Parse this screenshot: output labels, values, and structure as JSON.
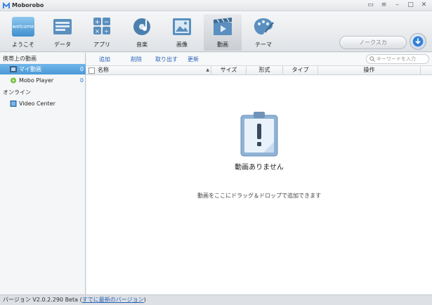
{
  "window": {
    "title": "Moborobo"
  },
  "toolbar": {
    "tabs": [
      {
        "label": "ようこそ",
        "icon": "welcome-icon"
      },
      {
        "label": "データ",
        "icon": "data-icon"
      },
      {
        "label": "アプリ",
        "icon": "apps-icon"
      },
      {
        "label": "音楽",
        "icon": "music-icon"
      },
      {
        "label": "画像",
        "icon": "image-icon"
      },
      {
        "label": "動画",
        "icon": "video-icon",
        "active": true
      },
      {
        "label": "テーマ",
        "icon": "theme-icon"
      }
    ],
    "welcome_badge": "welcome",
    "search_pill": "ノークスカ"
  },
  "sidebar": {
    "section_device": "携帯上の動画",
    "items_device": [
      {
        "label": "マイ動画",
        "count": "0",
        "selected": true
      },
      {
        "label": "Mobo Player",
        "count": "0"
      }
    ],
    "section_online": "オンライン",
    "items_online": [
      {
        "label": "Video Center"
      }
    ]
  },
  "actions": {
    "add": "追加",
    "delete": "削除",
    "export": "取り出す",
    "refresh": "更新"
  },
  "search": {
    "placeholder": "キーワードを入力"
  },
  "table": {
    "columns": [
      "名称",
      "サイズ",
      "形式",
      "タイプ",
      "操作"
    ]
  },
  "empty": {
    "title": "動画ありません",
    "hint": "動画をここにドラッグ＆ドロップで追加できます"
  },
  "status": {
    "version": "バージョン V2.0.2.290 Beta",
    "open_paren": "(",
    "latest_link": "すでに最新のバージョン",
    "close_paren": ")"
  },
  "colors": {
    "accent": "#4d9ad8",
    "link": "#2a63b8"
  }
}
